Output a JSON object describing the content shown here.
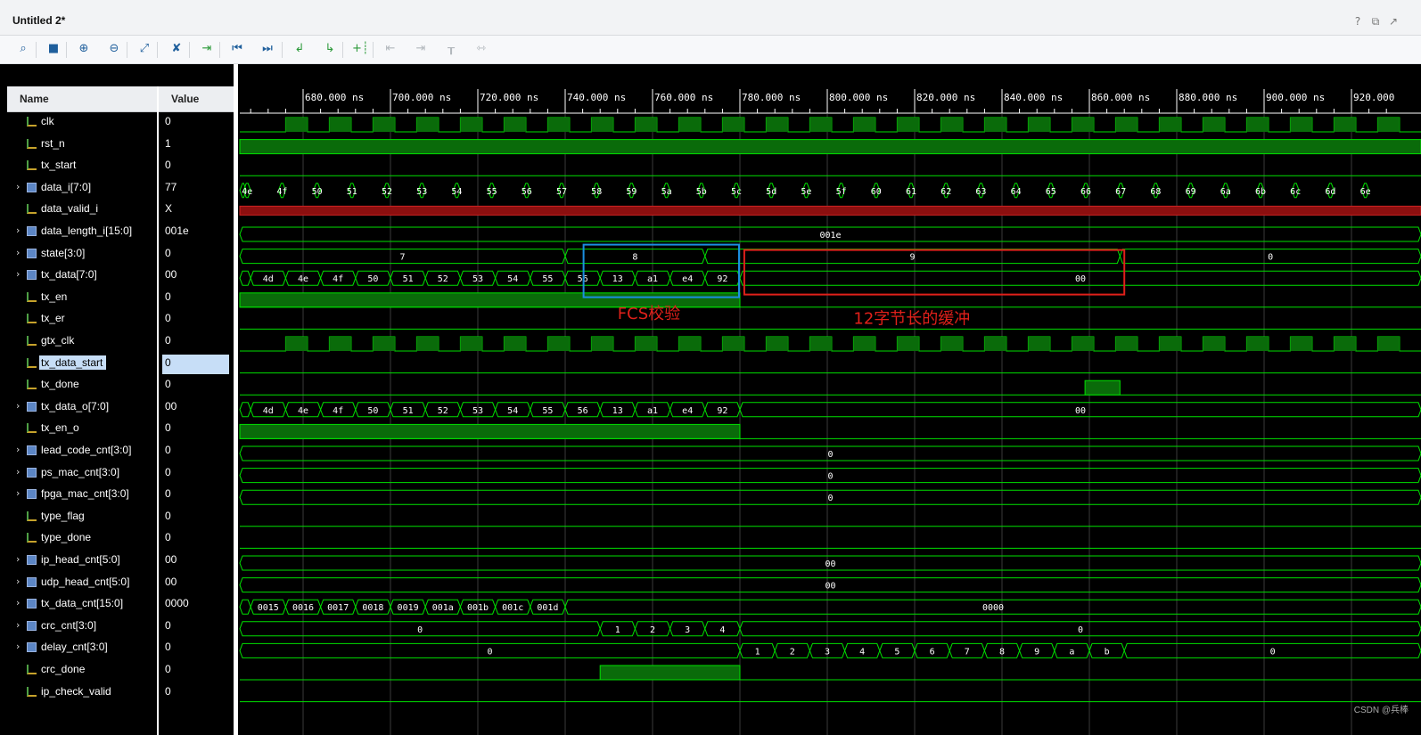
{
  "window": {
    "title": "Untitled 2*",
    "controls": [
      "?",
      "⧉",
      "↗"
    ]
  },
  "toolbar": {
    "buttons": [
      {
        "name": "search",
        "glyph": "⌕",
        "cls": ""
      },
      {
        "name": "save",
        "glyph": "■",
        "cls": ""
      },
      {
        "name": "zoom-in",
        "glyph": "⊕",
        "cls": ""
      },
      {
        "name": "zoom-out",
        "glyph": "⊖",
        "cls": ""
      },
      {
        "name": "zoom-fit",
        "glyph": "⤢",
        "cls": ""
      },
      {
        "name": "cursor-snap",
        "glyph": "✘",
        "cls": ""
      },
      {
        "name": "go-to-time",
        "glyph": "⇥",
        "cls": "g"
      },
      {
        "name": "go-to-start",
        "glyph": "⏮",
        "cls": ""
      },
      {
        "name": "go-to-end",
        "glyph": "⏭",
        "cls": ""
      },
      {
        "name": "previous-transition",
        "glyph": "↲",
        "cls": "g"
      },
      {
        "name": "next-transition",
        "glyph": "↳",
        "cls": "g"
      },
      {
        "name": "add-marker",
        "glyph": "+┊",
        "cls": "g"
      },
      {
        "name": "previous-marker",
        "glyph": "⇤",
        "cls": "dis"
      },
      {
        "name": "next-marker",
        "glyph": "⇥",
        "cls": "dis"
      },
      {
        "name": "swap-cursors",
        "glyph": "┰",
        "cls": "dis"
      },
      {
        "name": "fix-cursor",
        "glyph": "⇿",
        "cls": "dis"
      }
    ]
  },
  "columns": {
    "name": "Name",
    "value": "Value"
  },
  "signals": [
    {
      "name": "clk",
      "value": "0",
      "bus": false
    },
    {
      "name": "rst_n",
      "value": "1",
      "bus": false
    },
    {
      "name": "tx_start",
      "value": "0",
      "bus": false
    },
    {
      "name": "data_i[7:0]",
      "value": "77",
      "bus": true
    },
    {
      "name": "data_valid_i",
      "value": "X",
      "bus": false
    },
    {
      "name": "data_length_i[15:0]",
      "value": "001e",
      "bus": true
    },
    {
      "name": "state[3:0]",
      "value": "0",
      "bus": true
    },
    {
      "name": "tx_data[7:0]",
      "value": "00",
      "bus": true
    },
    {
      "name": "tx_en",
      "value": "0",
      "bus": false
    },
    {
      "name": "tx_er",
      "value": "0",
      "bus": false
    },
    {
      "name": "gtx_clk",
      "value": "0",
      "bus": false
    },
    {
      "name": "tx_data_start",
      "value": "0",
      "bus": false,
      "selected": true
    },
    {
      "name": "tx_done",
      "value": "0",
      "bus": false
    },
    {
      "name": "tx_data_o[7:0]",
      "value": "00",
      "bus": true
    },
    {
      "name": "tx_en_o",
      "value": "0",
      "bus": false
    },
    {
      "name": "lead_code_cnt[3:0]",
      "value": "0",
      "bus": true
    },
    {
      "name": "ps_mac_cnt[3:0]",
      "value": "0",
      "bus": true
    },
    {
      "name": "fpga_mac_cnt[3:0]",
      "value": "0",
      "bus": true
    },
    {
      "name": "type_flag",
      "value": "0",
      "bus": false
    },
    {
      "name": "type_done",
      "value": "0",
      "bus": false
    },
    {
      "name": "ip_head_cnt[5:0]",
      "value": "00",
      "bus": true
    },
    {
      "name": "udp_head_cnt[5:0]",
      "value": "00",
      "bus": true
    },
    {
      "name": "tx_data_cnt[15:0]",
      "value": "0000",
      "bus": true
    },
    {
      "name": "crc_cnt[3:0]",
      "value": "0",
      "bus": true
    },
    {
      "name": "delay_cnt[3:0]",
      "value": "0",
      "bus": true
    },
    {
      "name": "crc_done",
      "value": "0",
      "bus": false
    },
    {
      "name": "ip_check_valid",
      "value": "0",
      "bus": false
    }
  ],
  "timeline": {
    "ticks": [
      "680.000 ns",
      "700.000 ns",
      "720.000 ns",
      "740.000 ns",
      "760.000 ns",
      "780.000 ns",
      "800.000 ns",
      "820.000 ns",
      "840.000 ns",
      "860.000 ns",
      "880.000 ns",
      "900.000 ns",
      "920.000"
    ]
  },
  "waves": {
    "data_i": [
      "4e",
      "4f",
      "50",
      "51",
      "52",
      "53",
      "54",
      "55",
      "56",
      "57",
      "58",
      "59",
      "5a",
      "5b",
      "5c",
      "5d",
      "5e",
      "5f",
      "60",
      "61",
      "62",
      "63",
      "64",
      "65",
      "66",
      "67",
      "68",
      "69",
      "6a",
      "6b",
      "6c",
      "6d",
      "6e"
    ],
    "data_length": "001e",
    "state": [
      "7",
      "8",
      "9",
      "0"
    ],
    "tx_data": [
      "4d",
      "4e",
      "4f",
      "50",
      "51",
      "52",
      "53",
      "54",
      "55",
      "56",
      "13",
      "a1",
      "e4",
      "92"
    ],
    "tx_data_idle": "00",
    "tx_data_cnt": [
      "0015",
      "0016",
      "0017",
      "0018",
      "0019",
      "001a",
      "001b",
      "001c",
      "001d"
    ],
    "tx_data_cnt_idle": "0000",
    "crc_cnt": [
      "1",
      "2",
      "3",
      "4"
    ],
    "delay_cnt": [
      "1",
      "2",
      "3",
      "4",
      "5",
      "6",
      "7",
      "8",
      "9",
      "a",
      "b"
    ],
    "zero": "0",
    "zero2": "00"
  },
  "annotations": {
    "fcs": "FCS校验",
    "buffer": "12字节长的缓冲"
  },
  "colors": {
    "wave": "#00e000",
    "fill": "#0a6b0a",
    "red": "#e0201a",
    "blue": "#1b8fe0",
    "xstate": "#8c0f0f"
  },
  "watermark": "CSDN @兵棒"
}
